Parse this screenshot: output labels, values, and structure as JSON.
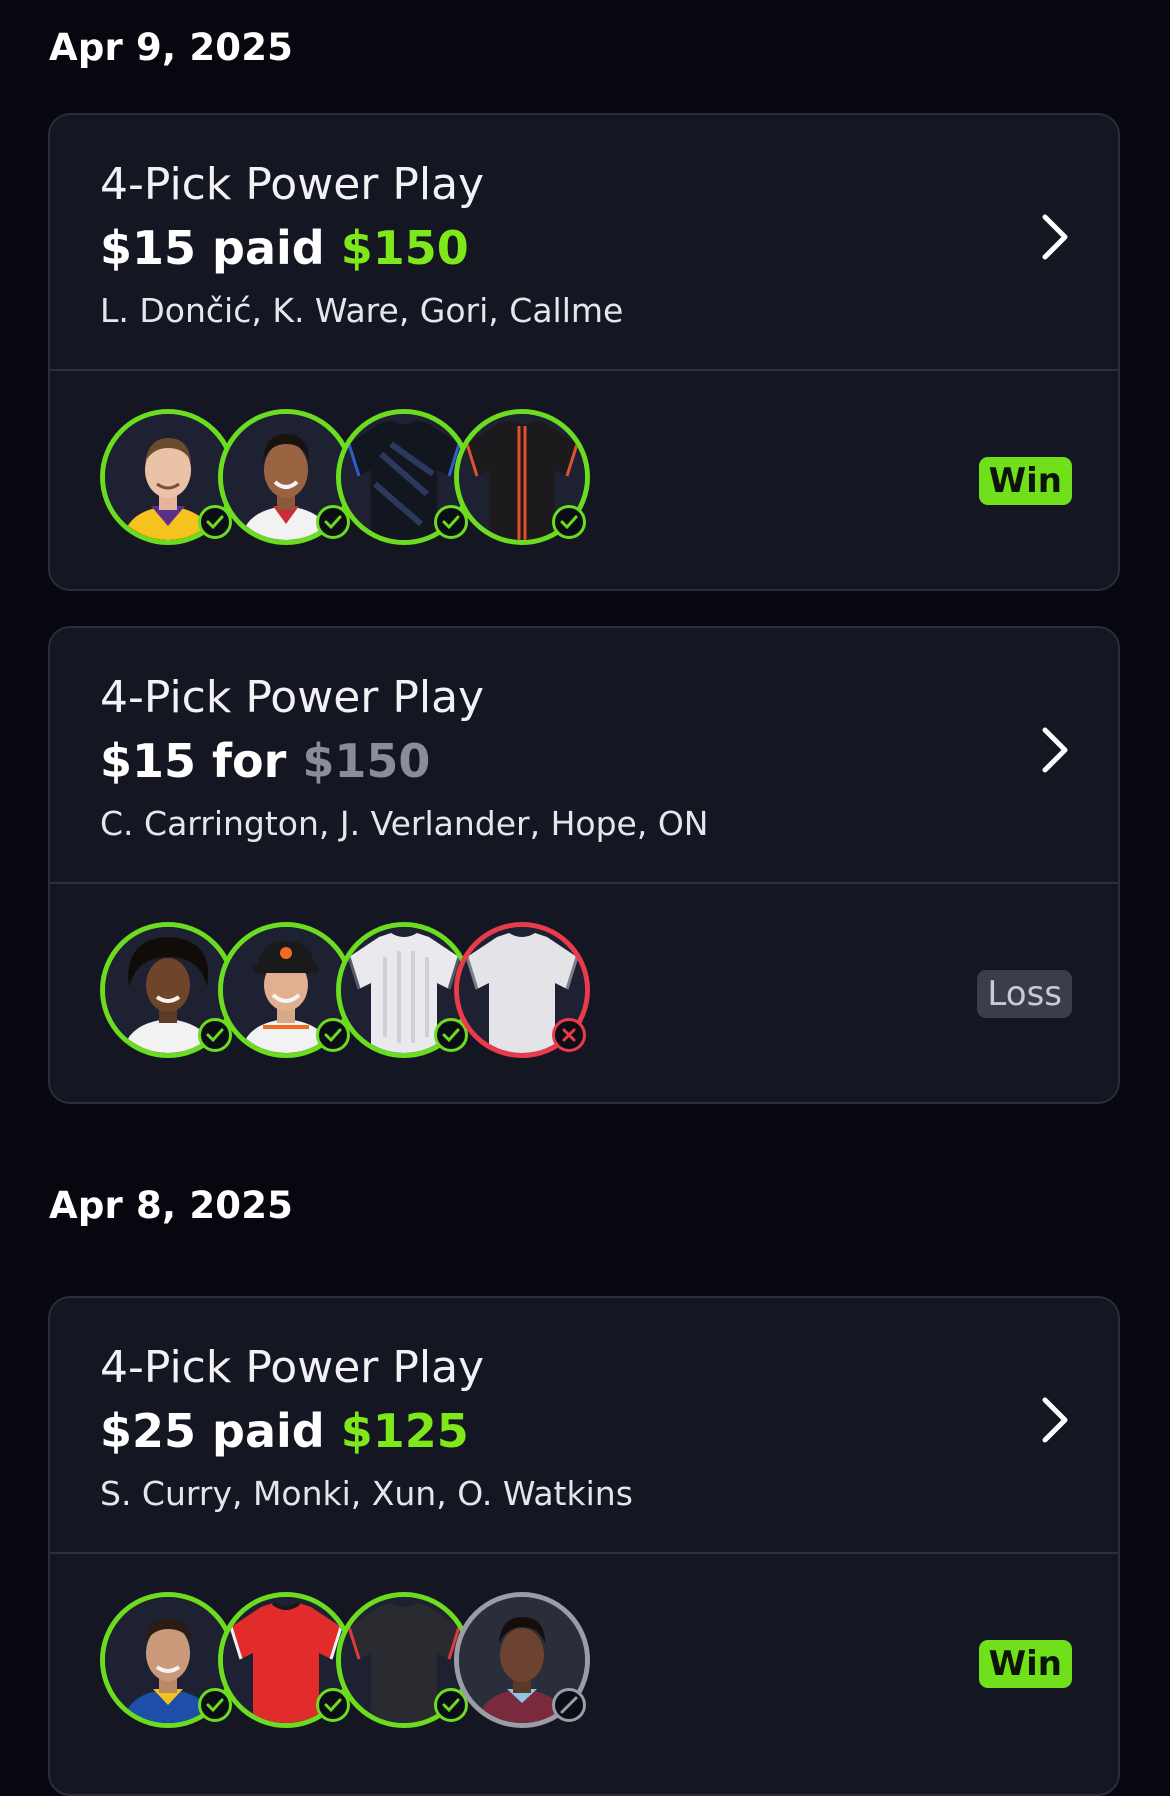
{
  "groups": [
    {
      "date": "Apr 9, 2025",
      "cards": [
        {
          "title": "4-Pick Power Play",
          "amount_prefix": "$15 paid",
          "amount_value": "$150",
          "players": "L. Dončić, K. Ware, Gori, Callme",
          "result": "Win",
          "picks": [
            {
              "name": "L. Dončić",
              "type": "headshot",
              "status": "won"
            },
            {
              "name": "K. Ware",
              "type": "headshot",
              "status": "won"
            },
            {
              "name": "Gori",
              "type": "jersey",
              "status": "won"
            },
            {
              "name": "Callme",
              "type": "jersey",
              "status": "won"
            }
          ]
        },
        {
          "title": "4-Pick Power Play",
          "amount_prefix": "$15 for",
          "amount_value": "$150",
          "players": "C. Carrington, J. Verlander, Hope, ON",
          "result": "Loss",
          "picks": [
            {
              "name": "C. Carrington",
              "type": "headshot",
              "status": "won"
            },
            {
              "name": "J. Verlander",
              "type": "headshot",
              "status": "won"
            },
            {
              "name": "Hope",
              "type": "jersey",
              "status": "won"
            },
            {
              "name": "ON",
              "type": "jersey",
              "status": "lost"
            }
          ]
        }
      ]
    },
    {
      "date": "Apr 8, 2025",
      "cards": [
        {
          "title": "4-Pick Power Play",
          "amount_prefix": "$25 paid",
          "amount_value": "$125",
          "players": "S. Curry, Monki, Xun, O. Watkins",
          "result": "Win",
          "picks": [
            {
              "name": "S. Curry",
              "type": "headshot",
              "status": "won"
            },
            {
              "name": "Monki",
              "type": "jersey",
              "status": "won"
            },
            {
              "name": "Xun",
              "type": "jersey",
              "status": "won"
            },
            {
              "name": "O. Watkins",
              "type": "headshot",
              "status": "void"
            }
          ]
        }
      ]
    }
  ],
  "colors": {
    "win_green": "#6fe01a",
    "loss_red": "#ea3b4c",
    "void_grey": "#9a9ca6",
    "card_bg": "#141621",
    "page_bg": "#06070f"
  },
  "icons": {
    "chevron": "chevron-right-icon",
    "won": "check-circle-icon",
    "lost": "x-circle-icon",
    "void": "ban-circle-icon"
  }
}
